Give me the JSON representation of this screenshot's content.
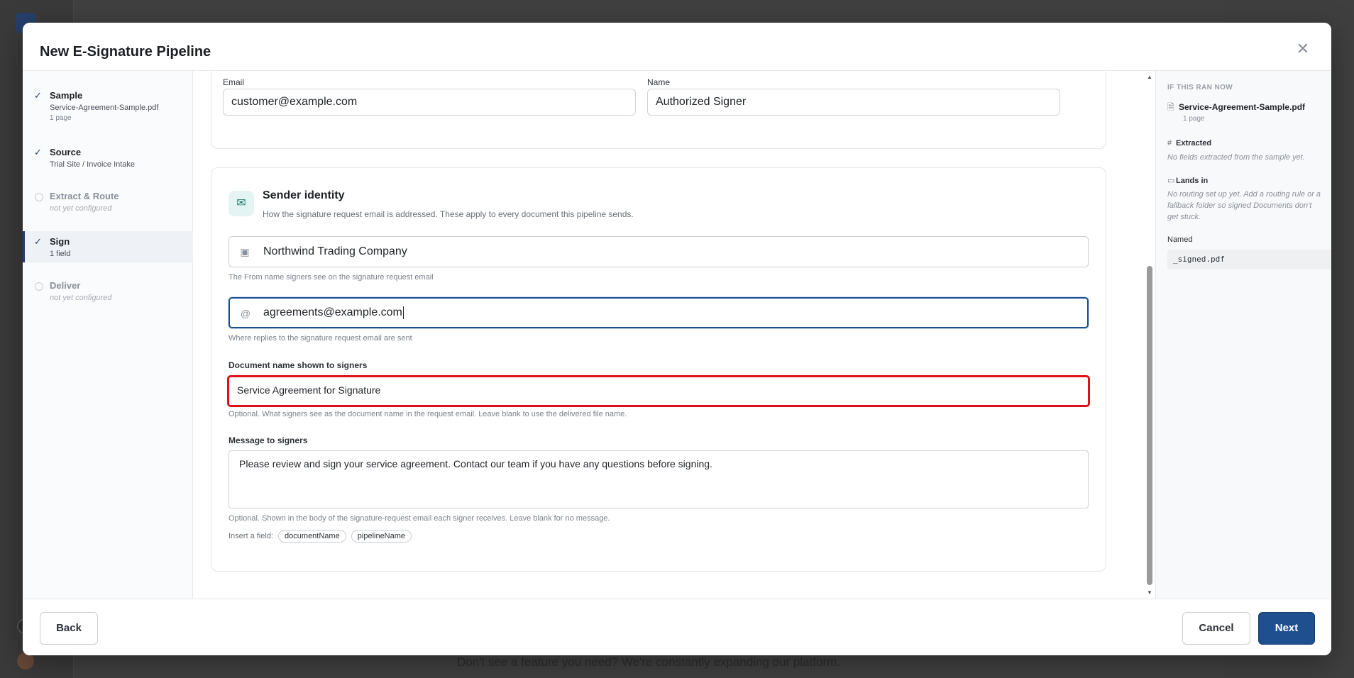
{
  "background": {
    "footer_text": "Don't see a feature you need? We're constantly expanding our platform."
  },
  "modal": {
    "title": "New E-Signature Pipeline",
    "close_icon": "close-icon"
  },
  "steps": [
    {
      "title": "Sample",
      "sub": "Service-Agreement-Sample.pdf",
      "meta": "1 page",
      "state": "done"
    },
    {
      "title": "Source",
      "sub": "Trial Site / Invoice Intake",
      "meta": "",
      "state": "done"
    },
    {
      "title": "Extract & Route",
      "sub": "not yet configured",
      "meta": "",
      "state": "pending"
    },
    {
      "title": "Sign",
      "sub": "1 field",
      "meta": "",
      "state": "active"
    },
    {
      "title": "Deliver",
      "sub": "not yet configured",
      "meta": "",
      "state": "pending"
    }
  ],
  "signer": {
    "email_label": "Email",
    "email_value": "customer@example.com",
    "name_label": "Name",
    "name_value": "Authorized Signer"
  },
  "sender": {
    "title": "Sender identity",
    "subtitle": "How the signature request email is addressed. These apply to every document this pipeline sends.",
    "from_name_value": "Northwind Trading Company",
    "from_name_help": "The From name signers see on the signature request email",
    "reply_to_value": "agreements@example.com",
    "reply_to_help": "Where replies to the signature request email are sent",
    "doc_name_label": "Document name shown to signers",
    "doc_name_value": "Service Agreement for Signature",
    "doc_name_help": "Optional. What signers see as the document name in the request email. Leave blank to use the delivered file name.",
    "message_label": "Message to signers",
    "message_value": "Please review and sign your service agreement. Contact our team if you have any questions before signing.",
    "message_help": "Optional. Shown in the body of the signature-request email each signer receives. Leave blank for no message.",
    "insert_label": "Insert a field:",
    "insert_fields": [
      "documentName",
      "pipelineName"
    ]
  },
  "preview": {
    "header": "IF THIS RAN NOW",
    "file": "Service-Agreement-Sample.pdf",
    "pages": "1 page",
    "extracted_label": "Extracted",
    "extracted_note": "No fields extracted from the sample yet.",
    "lands_label": "Lands in",
    "lands_note": "No routing set up yet. Add a routing rule or a fallback folder so signed Documents don't get stuck.",
    "named_label": "Named",
    "named_value": "_signed.pdf"
  },
  "footer": {
    "back": "Back",
    "cancel": "Cancel",
    "next": "Next"
  },
  "colors": {
    "primary": "#1f4f8f",
    "error": "#e0101a",
    "accent_teal": "#1d7a6f"
  }
}
